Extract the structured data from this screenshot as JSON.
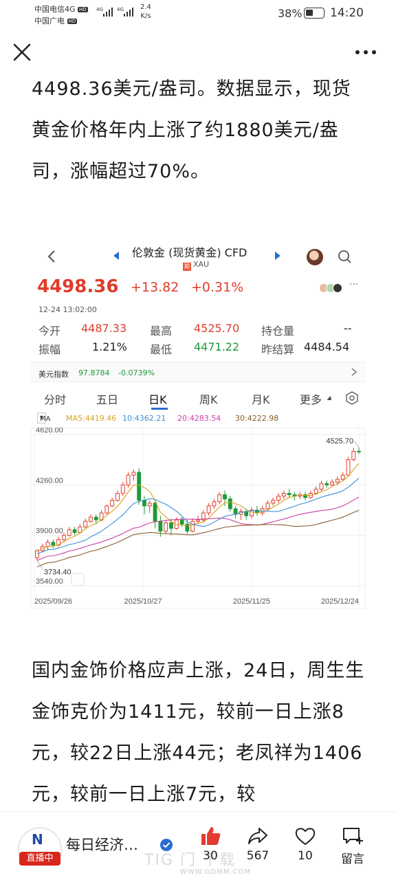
{
  "status_bar": {
    "carrier1": "中国电信4G",
    "carrier2": "中国广电",
    "hd": "HD",
    "sig1": "4G",
    "sig2": "4G",
    "speed_value": "2.4",
    "speed_unit": "K/s",
    "battery": "38%",
    "time": "14:20"
  },
  "article": {
    "para1": "4498.36美元/盎司。数据显示，现货黄金价格年内上涨了约1880美元/盎司，涨幅超过70%。",
    "para2": "国内金饰价格应声上涨，24日，周生生金饰克价为1411元，较前一日上涨8元，较22日上涨44元；老凤祥为1406元，较前一日上涨7元，较"
  },
  "figure": {
    "title": "伦敦金 (现货黄金) CFD",
    "subtitle": "XAU",
    "subtitle_tag": "期",
    "price": "4498.36",
    "change": "+13.82",
    "change_pct": "+0.31%",
    "timestamp": "12-24 13:02:00",
    "more": "···",
    "stats": [
      {
        "label": "今开",
        "value": "4487.33"
      },
      {
        "label": "最高",
        "value": "4525.70"
      },
      {
        "label": "持仓量",
        "value": "--"
      },
      {
        "label": "振幅",
        "value": "1.21%"
      },
      {
        "label": "最低",
        "value": "4471.22"
      },
      {
        "label": "昨结算",
        "value": "4484.54"
      }
    ],
    "dollar_index": {
      "label": "美元指数",
      "value": "97.8784",
      "change": "-0.0739%"
    },
    "tabs": [
      "分时",
      "五日",
      "日K",
      "周K",
      "月K",
      "更多"
    ],
    "active_tab": "日K",
    "ma": {
      "selector": "MA",
      "ma5": "MA5:4419.46",
      "ma10": "10:4362.21",
      "ma20": "20:4283.54",
      "ma30": "30:4222.98"
    },
    "colors": {
      "up": "#e03b2b",
      "down": "#1e9a38",
      "ma5": "#d9a21a",
      "ma10": "#3b8fd6",
      "ma20": "#cc3fa3",
      "ma30": "#8a5a2a",
      "accent": "#2a6bd6"
    }
  },
  "chart_data": {
    "type": "candlestick",
    "y_ticks": [
      "4620.00",
      "4260.00",
      "3900.00",
      "3540.00"
    ],
    "ylim": [
      3540,
      4620
    ],
    "x_ticks": [
      "2025/09/26",
      "2025/10/27",
      "2025/11/25",
      "2025/12/24"
    ],
    "max_label": "4525.70",
    "min_label": "3734.40",
    "candles": [
      [
        3740,
        3790,
        3720,
        3800
      ],
      [
        3790,
        3820,
        3780,
        3840
      ],
      [
        3820,
        3850,
        3800,
        3870
      ],
      [
        3850,
        3830,
        3810,
        3870
      ],
      [
        3830,
        3870,
        3820,
        3890
      ],
      [
        3870,
        3900,
        3850,
        3920
      ],
      [
        3900,
        3940,
        3890,
        3960
      ],
      [
        3940,
        3920,
        3900,
        3960
      ],
      [
        3920,
        3960,
        3910,
        3980
      ],
      [
        3960,
        4000,
        3950,
        4020
      ],
      [
        4000,
        4030,
        3990,
        4050
      ],
      [
        4030,
        4010,
        3980,
        4050
      ],
      [
        4010,
        4060,
        4000,
        4080
      ],
      [
        4060,
        4110,
        4050,
        4120
      ],
      [
        4110,
        4150,
        4100,
        4170
      ],
      [
        4150,
        4200,
        4140,
        4220
      ],
      [
        4200,
        4260,
        4180,
        4280
      ],
      [
        4260,
        4330,
        4240,
        4350
      ],
      [
        4330,
        4350,
        4290,
        4370
      ],
      [
        4350,
        4150,
        4120,
        4380
      ],
      [
        4150,
        4110,
        4050,
        4180
      ],
      [
        4110,
        4130,
        4060,
        4150
      ],
      [
        4130,
        4000,
        3950,
        4150
      ],
      [
        4000,
        3930,
        3890,
        4040
      ],
      [
        3930,
        3990,
        3910,
        4010
      ],
      [
        3990,
        3950,
        3900,
        4020
      ],
      [
        3950,
        4010,
        3940,
        4030
      ],
      [
        4010,
        3980,
        3960,
        4030
      ],
      [
        3980,
        3930,
        3910,
        4010
      ],
      [
        3930,
        4000,
        3920,
        4020
      ],
      [
        4000,
        4010,
        3980,
        4040
      ],
      [
        4010,
        4060,
        3990,
        4080
      ],
      [
        4060,
        4110,
        4040,
        4130
      ],
      [
        4110,
        4140,
        4090,
        4160
      ],
      [
        4140,
        4190,
        4120,
        4210
      ],
      [
        4190,
        4160,
        4110,
        4220
      ],
      [
        4160,
        4090,
        4070,
        4180
      ],
      [
        4090,
        4050,
        4020,
        4110
      ],
      [
        4050,
        4070,
        4010,
        4090
      ],
      [
        4070,
        4040,
        4010,
        4090
      ],
      [
        4040,
        4080,
        4020,
        4100
      ],
      [
        4080,
        4060,
        4040,
        4110
      ],
      [
        4060,
        4090,
        4040,
        4110
      ],
      [
        4090,
        4130,
        4080,
        4150
      ],
      [
        4130,
        4150,
        4110,
        4170
      ],
      [
        4150,
        4180,
        4130,
        4200
      ],
      [
        4180,
        4200,
        4160,
        4220
      ],
      [
        4200,
        4190,
        4170,
        4230
      ],
      [
        4190,
        4180,
        4150,
        4210
      ],
      [
        4180,
        4190,
        4160,
        4210
      ],
      [
        4190,
        4170,
        4150,
        4210
      ],
      [
        4170,
        4200,
        4160,
        4220
      ],
      [
        4200,
        4230,
        4190,
        4250
      ],
      [
        4230,
        4270,
        4210,
        4290
      ],
      [
        4270,
        4260,
        4240,
        4290
      ],
      [
        4260,
        4280,
        4250,
        4300
      ],
      [
        4280,
        4300,
        4260,
        4320
      ],
      [
        4300,
        4330,
        4290,
        4350
      ],
      [
        4330,
        4440,
        4320,
        4460
      ],
      [
        4440,
        4500,
        4430,
        4526
      ],
      [
        4500,
        4498,
        4480,
        4526
      ]
    ]
  },
  "bottom_bar": {
    "brand_mark": "N",
    "live": "直播中",
    "name": "每日经济…",
    "likes": "30",
    "shares": "567",
    "favorites": "10",
    "comments": "留言",
    "watermark": "TIG 门 下载",
    "watermark_url": "WWW.GDMM.COM"
  }
}
